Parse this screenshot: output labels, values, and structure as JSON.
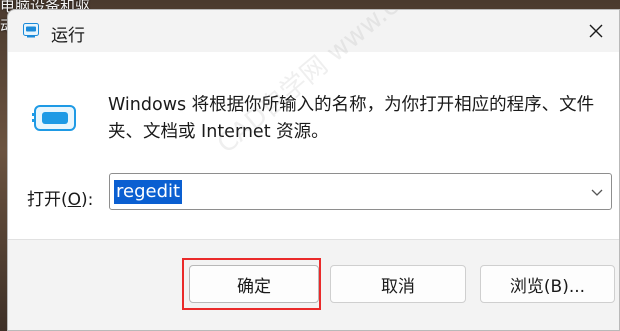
{
  "background": {
    "text": "电脑设备和驱\n动"
  },
  "dialog": {
    "title": "运行",
    "close_icon": "close-icon",
    "description": "Windows 将根据你所输入的名称，为你打开相应的程序、文件夹、文档或 Internet 资源。",
    "open_label_prefix": "打开(",
    "open_label_hotkey": "O",
    "open_label_suffix": "):",
    "command_value": "regedit",
    "buttons": {
      "ok": "确定",
      "cancel": "取消",
      "browse": "浏览(B)..."
    }
  },
  "watermark": "CAD自学网 www.cadzxw.com",
  "colors": {
    "accent": "#0a5fd1",
    "highlight": "#ea2a2a"
  }
}
